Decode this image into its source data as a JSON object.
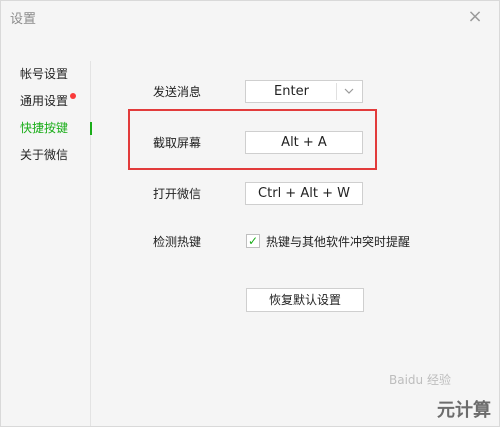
{
  "window": {
    "title": "设置",
    "close_glyph": "×"
  },
  "sidebar": {
    "items": [
      {
        "label": "帐号设置",
        "active": false,
        "badge": false
      },
      {
        "label": "通用设置",
        "active": false,
        "badge": true
      },
      {
        "label": "快捷按键",
        "active": true,
        "badge": false
      },
      {
        "label": "关于微信",
        "active": false,
        "badge": false
      }
    ],
    "active_color": "#1aad19",
    "badge_color": "#fa3a3a"
  },
  "shortcuts": {
    "send_message": {
      "label": "发送消息",
      "value": "Enter",
      "dropdown_icon": "chevron-down-icon"
    },
    "screenshot": {
      "label": "截取屏幕",
      "value": "Alt + A"
    },
    "open_wechat": {
      "label": "打开微信",
      "value": "Ctrl + Alt + W"
    },
    "hotkey_detect": {
      "label": "检测热键",
      "checkbox_label": "热键与其他软件冲突时提醒",
      "checked": true
    },
    "reset_label": "恢复默认设置"
  },
  "annotation": {
    "highlight_color": "#e23b3b"
  },
  "watermark": {
    "text": "元计算",
    "baidu_text": "Baidu 经验"
  }
}
